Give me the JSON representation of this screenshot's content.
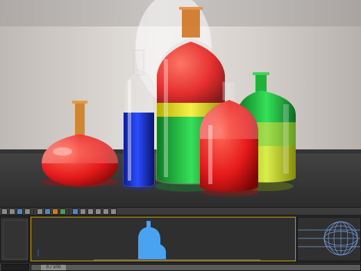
{
  "toolbar": {
    "icons": [
      "select-icon",
      "move-icon",
      "rotate-icon",
      "scale-icon",
      "link-icon",
      "camera-icon",
      "light-icon",
      "material-icon",
      "render-icon",
      "render-frame-icon",
      "settings-icon",
      "undo-icon",
      "redo-icon",
      "snap-icon"
    ]
  },
  "timeslider": {
    "frame_label": "0 / 100",
    "progress": 0.0
  },
  "colors": {
    "background_wall": "#cfcac6",
    "table": "#3a3a3a",
    "bottle_red": "#e01a1a",
    "bottle_blue": "#1c3cff",
    "bottle_green": "#1fd24a",
    "bottle_yellow": "#f0ea25",
    "bottle_amber": "#d07a15",
    "viewport_silhouette": "#4aa3f0",
    "active_viewport_border": "#c8a000",
    "wireframe_blue": "#7fb0ff"
  }
}
